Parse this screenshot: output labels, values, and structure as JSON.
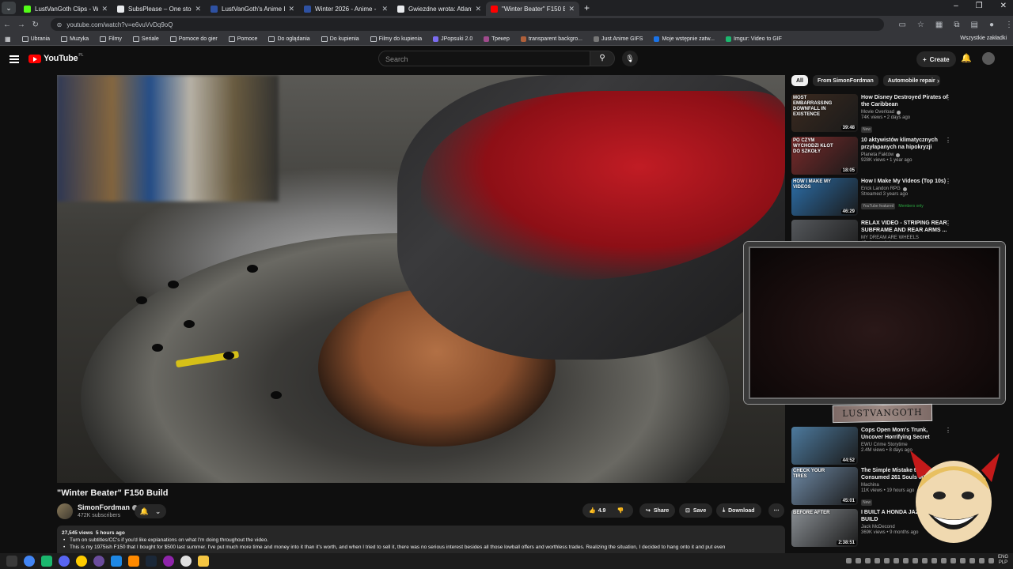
{
  "browser": {
    "tabs": [
      {
        "title": "LustVanGoth Clips - Watch Live",
        "color": "#53fc18",
        "active": false
      },
      {
        "title": "SubsPlease – One stop shop for",
        "color": "#e8eaed",
        "active": false
      },
      {
        "title": "LustVanGoth's Anime List - My",
        "color": "#2e51a2",
        "active": false
      },
      {
        "title": "Winter 2026 - Anime - MyAnim",
        "color": "#2e51a2",
        "active": false
      },
      {
        "title": "Gwiezdne wrota: Atlantyda / St",
        "color": "#e8eaed",
        "active": false
      },
      {
        "title": "\"Winter Beater\" F150 Build - Yo",
        "color": "#ff0000",
        "active": true
      }
    ],
    "url": "youtube.com/watch?v=e6vuVvDq9oQ",
    "bookmarks": [
      {
        "label": "Ubrania",
        "type": "folder"
      },
      {
        "label": "Muzyka",
        "type": "folder"
      },
      {
        "label": "Filmy",
        "type": "folder"
      },
      {
        "label": "Seriale",
        "type": "folder"
      },
      {
        "label": "Pomoce do gier",
        "type": "folder"
      },
      {
        "label": "Pomoce",
        "type": "folder"
      },
      {
        "label": "Do oglądania",
        "type": "folder"
      },
      {
        "label": "Do kupienia",
        "type": "folder"
      },
      {
        "label": "Filmy do kupienia",
        "type": "folder"
      },
      {
        "label": "JPopsuki 2.0",
        "type": "site",
        "color": "#7b6cf0"
      },
      {
        "label": "Трекер",
        "type": "site",
        "color": "#a04b8c"
      },
      {
        "label": "transparent backgro...",
        "type": "site",
        "color": "#b0603a"
      },
      {
        "label": "Just Anime GIFS",
        "type": "site",
        "color": "#777777"
      },
      {
        "label": "Moje wstępnie zatw...",
        "type": "site",
        "color": "#1a73e8"
      },
      {
        "label": "Imgur: Video to GIF",
        "type": "site",
        "color": "#1bb76e"
      }
    ],
    "bookmarks_right": "Wszystkie zakładki"
  },
  "youtube": {
    "logo_text": "YouTube",
    "region": "PL",
    "search_placeholder": "Search",
    "create_label": "Create",
    "video": {
      "title": "\"Winter Beater\" F150 Build",
      "channel": "SimonFordman",
      "subscribers": "472K subscribers",
      "likes": "4.9",
      "share": "Share",
      "save": "Save",
      "download": "Download",
      "views": "27,545 views",
      "age": "5 hours ago",
      "desc_lines": [
        "Turn on subtitles/CC's if you'd like explanations on what I'm doing throughout the video.",
        "This is my 1975ish F150 that I bought for $500 last summer. I've put much more time and money into it than it's worth, and when I tried to sell it, there was no serious interest besides all those lowball offers and worthless trades. Realizing the situation, I decided to hang onto it and put even"
      ]
    },
    "chips": [
      "All",
      "From SimonFordman",
      "Automobile repair"
    ],
    "recs": [
      {
        "title": "How Disney Destroyed Pirates of the Caribbean",
        "channel": "Movie Overload",
        "verified": true,
        "views": "74K views • 2 days ago",
        "badge": "New",
        "duration": "39:48",
        "thumb_text": "MOST EMBARRASSING DOWNFALL IN EXISTENCE",
        "bg": "#3b2a1f"
      },
      {
        "title": "10 aktywistów klimatycznych przyłapanych na hipokryzji",
        "channel": "Planeta Faktów",
        "verified": true,
        "views": "928K views • 1 year ago",
        "badge": "",
        "duration": "18:05",
        "thumb_text": "PO CZYM WYCHODZI KŁOT DO SZKOŁY",
        "bg": "#7a2a2a"
      },
      {
        "title": "How I Make My Videos (Top 10s)",
        "channel": "Erick Landon RPG",
        "verified": true,
        "views": "Streamed 3 years ago",
        "badge": "YouTube featured",
        "members": "Members only",
        "duration": "46:29",
        "thumb_text": "HOW I MAKE MY VIDEOS",
        "bg": "#2c6ea8"
      },
      {
        "title": "RELAX VIDEO - STRIPING REAR SUBFRAME AND REAR ARMS ...",
        "channel": "MY DREAM ARE WHEELS",
        "verified": false,
        "views": "43 views • 4 days ago",
        "badge": "",
        "duration": "",
        "thumb_text": "",
        "bg": "#55585c"
      },
      {
        "title": "Cops Open Mom's Trunk, Uncover Horrifying Secret",
        "channel": "EWU Crime Storytime",
        "verified": false,
        "views": "2.4M views • 8 days ago",
        "badge": "",
        "duration": "44:52",
        "thumb_text": "",
        "bg": "#4d7a9e"
      },
      {
        "title": "The Simple Mistake that Consumed 261 Souls MID-",
        "channel": "Machina",
        "verified": false,
        "views": "11K views • 19 hours ago",
        "badge": "New",
        "duration": "45:01",
        "thumb_text": "CHECK YOUR TIRES",
        "bg": "#6f8aa6"
      },
      {
        "title": "I BUILT A HONDA JAZZ - FULL BUILD",
        "channel": "Jack McDecond",
        "verified": false,
        "views": "369K views • 9 months ago",
        "badge": "",
        "duration": "2:38:51",
        "thumb_text": "BEFORE AFTER",
        "bg": "#8a8f94"
      }
    ]
  },
  "overlay": {
    "label": "LUSTVANGOTH"
  },
  "taskbar": {
    "tray_lang": "ENG",
    "tray_locale": "PLP"
  }
}
